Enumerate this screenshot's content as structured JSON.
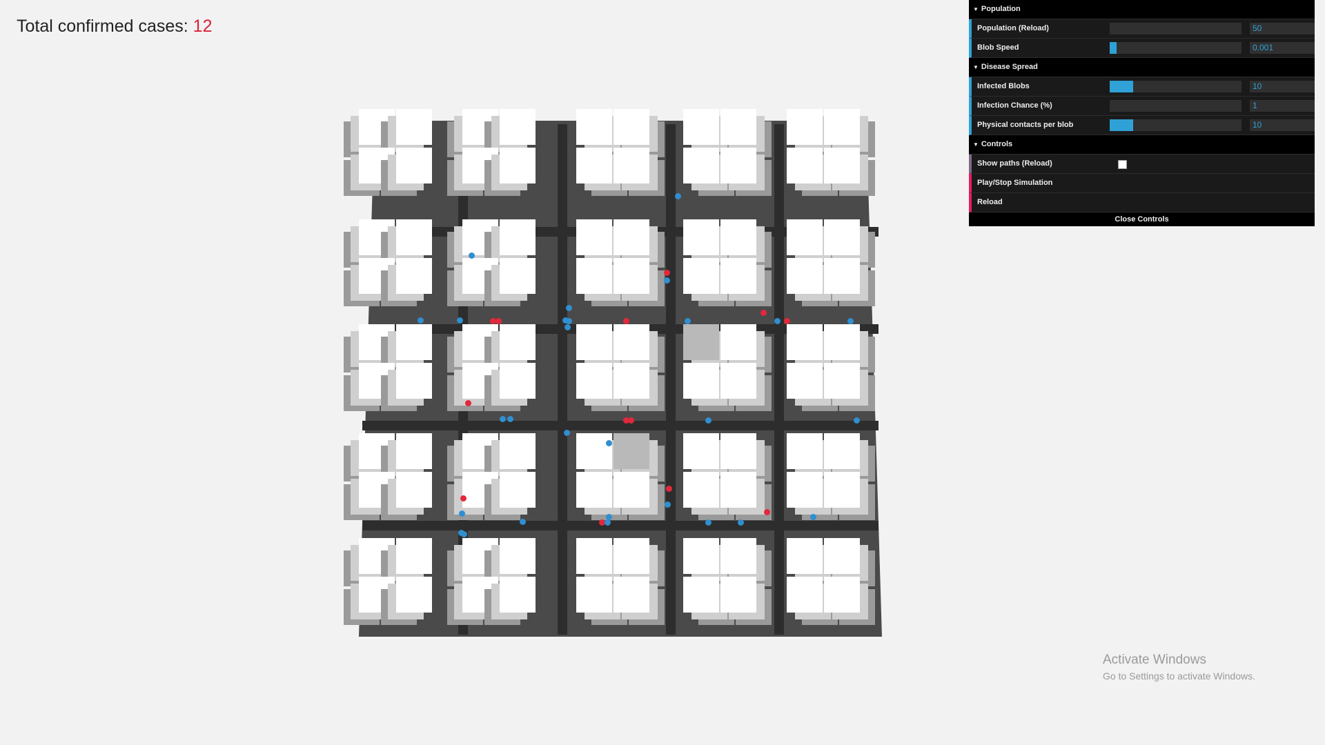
{
  "counter": {
    "label": "Total confirmed cases:",
    "value": "12"
  },
  "gui": {
    "folders": [
      {
        "title": "Population",
        "rows": [
          {
            "label": "Population (Reload)",
            "value": "50",
            "fill": 0
          },
          {
            "label": "Blob Speed",
            "value": "0.001",
            "fill": 0.05
          }
        ]
      },
      {
        "title": "Disease Spread",
        "rows": [
          {
            "label": "Infected Blobs",
            "value": "10",
            "fill": 0.18
          },
          {
            "label": "Infection Chance (%)",
            "value": "1",
            "fill": 0
          },
          {
            "label": "Physical contacts per blob",
            "value": "10",
            "fill": 0.18
          }
        ]
      },
      {
        "title": "Controls",
        "rows": [
          {
            "label": "Show paths (Reload)",
            "checked": false
          },
          {
            "label": "Play/Stop Simulation"
          },
          {
            "label": "Reload"
          }
        ]
      }
    ],
    "close_label": "Close Controls"
  },
  "watermark": {
    "title": "Activate Windows",
    "subtitle": "Go to Settings to activate Windows."
  },
  "colors": {
    "healthy": "#2f8fd0",
    "infected": "#e3283c",
    "accent": "#2fa1d6",
    "count": "#d6233b"
  }
}
